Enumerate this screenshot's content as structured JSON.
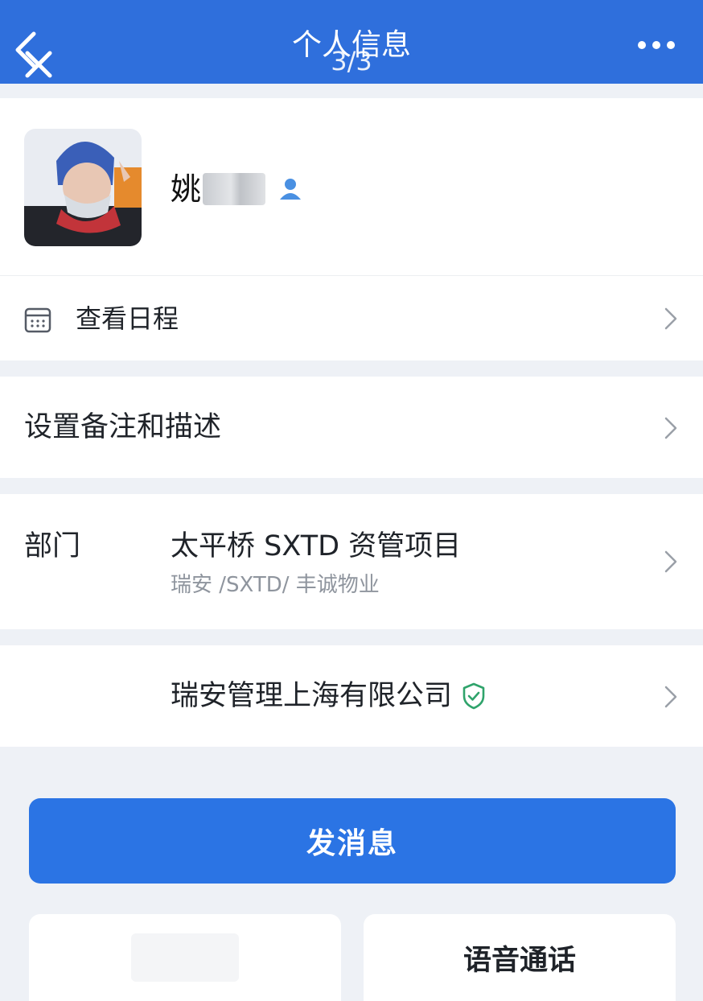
{
  "header": {
    "title": "个人信息",
    "page_indicator": "3/3",
    "background": "#2f6fdc"
  },
  "profile": {
    "name_visible": "姚",
    "contact_badge_icon": "person-icon"
  },
  "schedule": {
    "label": "查看日程",
    "icon": "calendar-icon"
  },
  "remark": {
    "label": "设置备注和描述"
  },
  "department": {
    "label": "部门",
    "value": "太平桥 SXTD 资管项目",
    "path": "瑞安 /SXTD/ 丰诚物业"
  },
  "company": {
    "value": "瑞安管理上海有限公司",
    "verified_icon": "shield-check-icon",
    "verified_color": "#2fa36b"
  },
  "actions": {
    "send_message": "发消息",
    "voice_call": "语音通话",
    "accent": "#2b74e4"
  }
}
